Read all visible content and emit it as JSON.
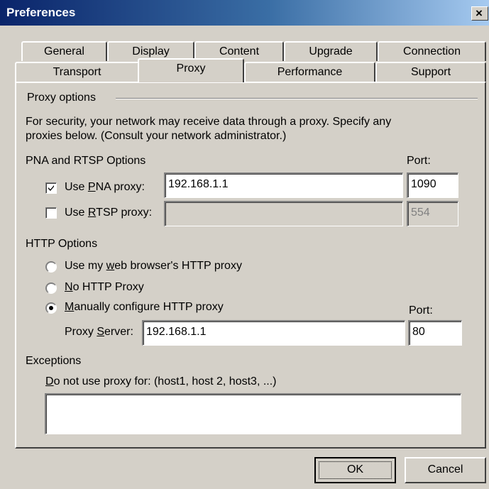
{
  "window": {
    "title": "Preferences",
    "close_label": "×"
  },
  "tabs_row1": [
    "General",
    "Display",
    "Content",
    "Upgrade",
    "Connection"
  ],
  "tabs_row2": [
    "Transport",
    "Proxy",
    "Performance",
    "Support"
  ],
  "active_tab": "Proxy",
  "proxy_options": {
    "heading": "Proxy options",
    "description_line1": "For security, your network may receive data through a proxy. Specify any",
    "description_line2": "proxies below. (Consult your network administrator.)"
  },
  "pna_rtsp": {
    "heading": "PNA and RTSP Options",
    "port_label": "Port:",
    "pna": {
      "label_pre": "Use ",
      "label_ul": "P",
      "label_post": "NA proxy:",
      "checked": true,
      "host": "192.168.1.1",
      "port": "1090"
    },
    "rtsp": {
      "label_pre": "Use ",
      "label_ul": "R",
      "label_post": "TSP proxy:",
      "checked": false,
      "host": "",
      "port": "554"
    }
  },
  "http": {
    "heading": "HTTP Options",
    "opt_browser": {
      "pre": "Use my ",
      "ul": "w",
      "post": "eb browser's HTTP proxy",
      "selected": false
    },
    "opt_none": {
      "pre": "",
      "ul": "N",
      "post": "o HTTP Proxy",
      "selected": false
    },
    "opt_manual": {
      "pre": "",
      "ul": "M",
      "post": "anually configure HTTP proxy",
      "selected": true
    },
    "port_label": "Port:",
    "server_label_pre": "Proxy ",
    "server_label_ul": "S",
    "server_label_post": "erver:",
    "server": "192.168.1.1",
    "port": "80"
  },
  "exceptions": {
    "heading": "Exceptions",
    "label_ul": "D",
    "label_post": "o not use proxy for: (host1, host 2, host3, ...)",
    "value": ""
  },
  "buttons": {
    "ok": "OK",
    "cancel": "Cancel"
  }
}
